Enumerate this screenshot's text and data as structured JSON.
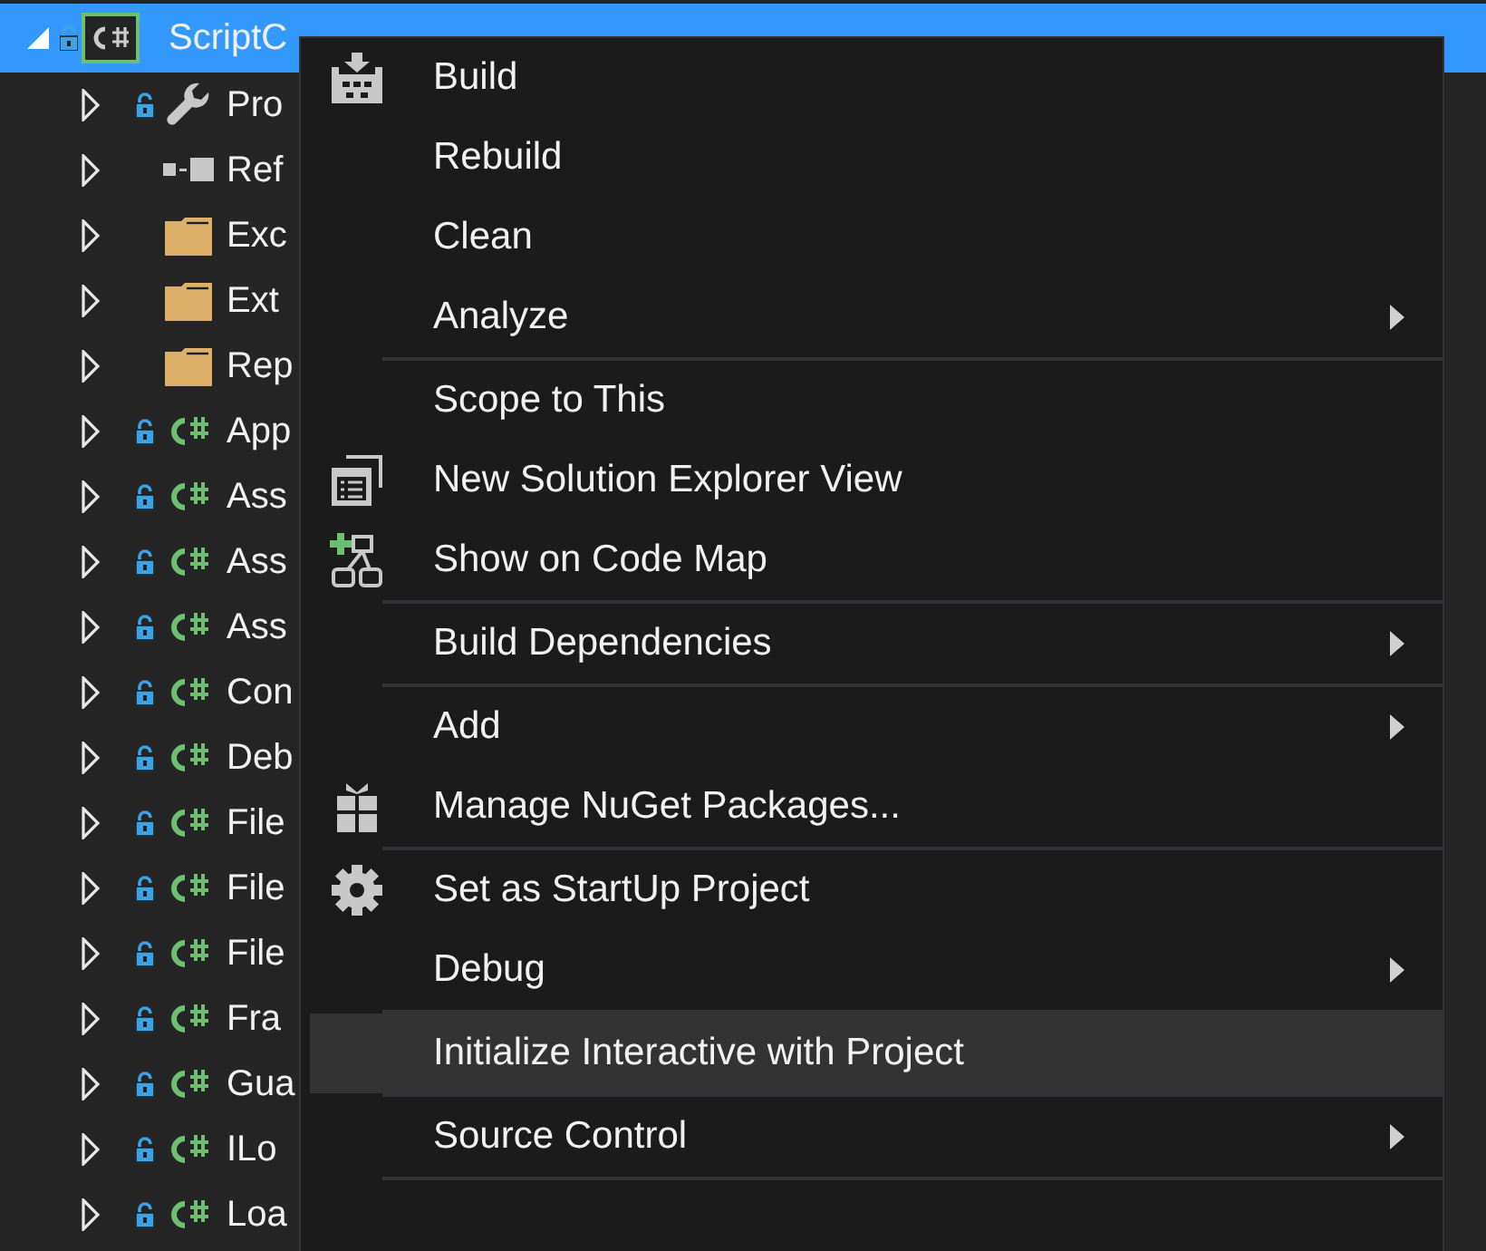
{
  "tree": {
    "root": {
      "label": "ScriptC",
      "expanded": true,
      "selected": true,
      "locked": true,
      "children": [
        {
          "label": "Pro",
          "kind": "properties",
          "locked": true,
          "expanded": false
        },
        {
          "label": "Ref",
          "kind": "references",
          "locked": false,
          "expanded": false
        },
        {
          "label": "Exc",
          "kind": "folder",
          "locked": false,
          "expanded": false
        },
        {
          "label": "Ext",
          "kind": "folder",
          "locked": false,
          "expanded": false
        },
        {
          "label": "Rep",
          "kind": "folder",
          "locked": false,
          "expanded": false
        },
        {
          "label": "App",
          "kind": "csharp",
          "locked": true,
          "expanded": false
        },
        {
          "label": "Ass",
          "kind": "csharp",
          "locked": true,
          "expanded": false
        },
        {
          "label": "Ass",
          "kind": "csharp",
          "locked": true,
          "expanded": false
        },
        {
          "label": "Ass",
          "kind": "csharp",
          "locked": true,
          "expanded": false
        },
        {
          "label": "Con",
          "kind": "csharp",
          "locked": true,
          "expanded": false
        },
        {
          "label": "Deb",
          "kind": "csharp",
          "locked": true,
          "expanded": false
        },
        {
          "label": "File",
          "kind": "csharp",
          "locked": true,
          "expanded": false
        },
        {
          "label": "File",
          "kind": "csharp",
          "locked": true,
          "expanded": false
        },
        {
          "label": "File",
          "kind": "csharp",
          "locked": true,
          "expanded": false
        },
        {
          "label": "Fra",
          "kind": "csharp",
          "locked": true,
          "expanded": false
        },
        {
          "label": "Gua",
          "kind": "csharp",
          "locked": true,
          "expanded": false
        },
        {
          "label": "ILo",
          "kind": "csharp",
          "locked": true,
          "expanded": false
        },
        {
          "label": "Loa",
          "kind": "csharp",
          "locked": true,
          "expanded": false
        }
      ]
    }
  },
  "context_menu": {
    "groups": [
      {
        "items": [
          {
            "label": "Build",
            "kind": "build",
            "submenu": false,
            "selected": false
          },
          {
            "label": "Rebuild",
            "kind": "plain",
            "submenu": false,
            "selected": false
          },
          {
            "label": "Clean",
            "kind": "plain",
            "submenu": false,
            "selected": false
          },
          {
            "label": "Analyze",
            "kind": "plain",
            "submenu": true,
            "selected": false
          }
        ]
      },
      {
        "items": [
          {
            "label": "Scope to This",
            "kind": "plain",
            "submenu": false,
            "selected": false
          },
          {
            "label": "New Solution Explorer View",
            "kind": "views",
            "submenu": false,
            "selected": false
          },
          {
            "label": "Show on Code Map",
            "kind": "codemap",
            "submenu": false,
            "selected": false
          }
        ]
      },
      {
        "items": [
          {
            "label": "Build Dependencies",
            "kind": "plain",
            "submenu": true,
            "selected": false
          }
        ]
      },
      {
        "items": [
          {
            "label": "Add",
            "kind": "plain",
            "submenu": true,
            "selected": false
          },
          {
            "label": "Manage NuGet Packages...",
            "kind": "package",
            "submenu": false,
            "selected": false
          }
        ]
      },
      {
        "items": [
          {
            "label": "Set as StartUp Project",
            "kind": "gear",
            "submenu": false,
            "selected": false
          },
          {
            "label": "Debug",
            "kind": "plain",
            "submenu": true,
            "selected": false
          }
        ]
      },
      {
        "items": [
          {
            "label": "Initialize Interactive with Project",
            "kind": "plain",
            "submenu": false,
            "selected": true
          }
        ]
      },
      {
        "items": [
          {
            "label": "Source Control",
            "kind": "plain",
            "submenu": true,
            "selected": false
          }
        ]
      }
    ]
  }
}
